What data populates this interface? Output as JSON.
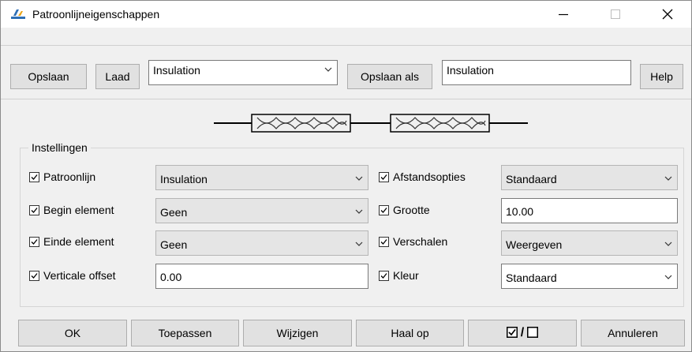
{
  "window": {
    "title": "Patroonlijneigenschappen",
    "controls": {
      "minimize": "—",
      "maximize": "☐",
      "close": "✕"
    }
  },
  "toolbar": {
    "save_label": "Opslaan",
    "load_label": "Laad",
    "pattern_select_value": "Insulation",
    "save_as_label": "Opslaan als",
    "save_as_name": "Insulation",
    "help_label": "Help"
  },
  "settings": {
    "group_title": "Instellingen",
    "left": [
      {
        "label": "Patroonlijn",
        "checked": true,
        "value": "Insulation",
        "kind": "select"
      },
      {
        "label": "Begin element",
        "checked": true,
        "value": "Geen",
        "kind": "select"
      },
      {
        "label": "Einde element",
        "checked": true,
        "value": "Geen",
        "kind": "select"
      },
      {
        "label": "Verticale offset",
        "checked": true,
        "value": "0.00",
        "kind": "text"
      }
    ],
    "right": [
      {
        "label": "Afstandsopties",
        "checked": true,
        "value": "Standaard",
        "kind": "select"
      },
      {
        "label": "Grootte",
        "checked": true,
        "value": "10.00",
        "kind": "text"
      },
      {
        "label": "Verschalen",
        "checked": true,
        "value": "Weergeven",
        "kind": "select"
      },
      {
        "label": "Kleur",
        "checked": true,
        "value": "Standaard",
        "kind": "select-white"
      }
    ]
  },
  "footer": {
    "ok": "OK",
    "apply": "Toepassen",
    "modify": "Wijzigen",
    "fetch": "Haal op",
    "toggle_separator": "/",
    "cancel": "Annuleren"
  }
}
